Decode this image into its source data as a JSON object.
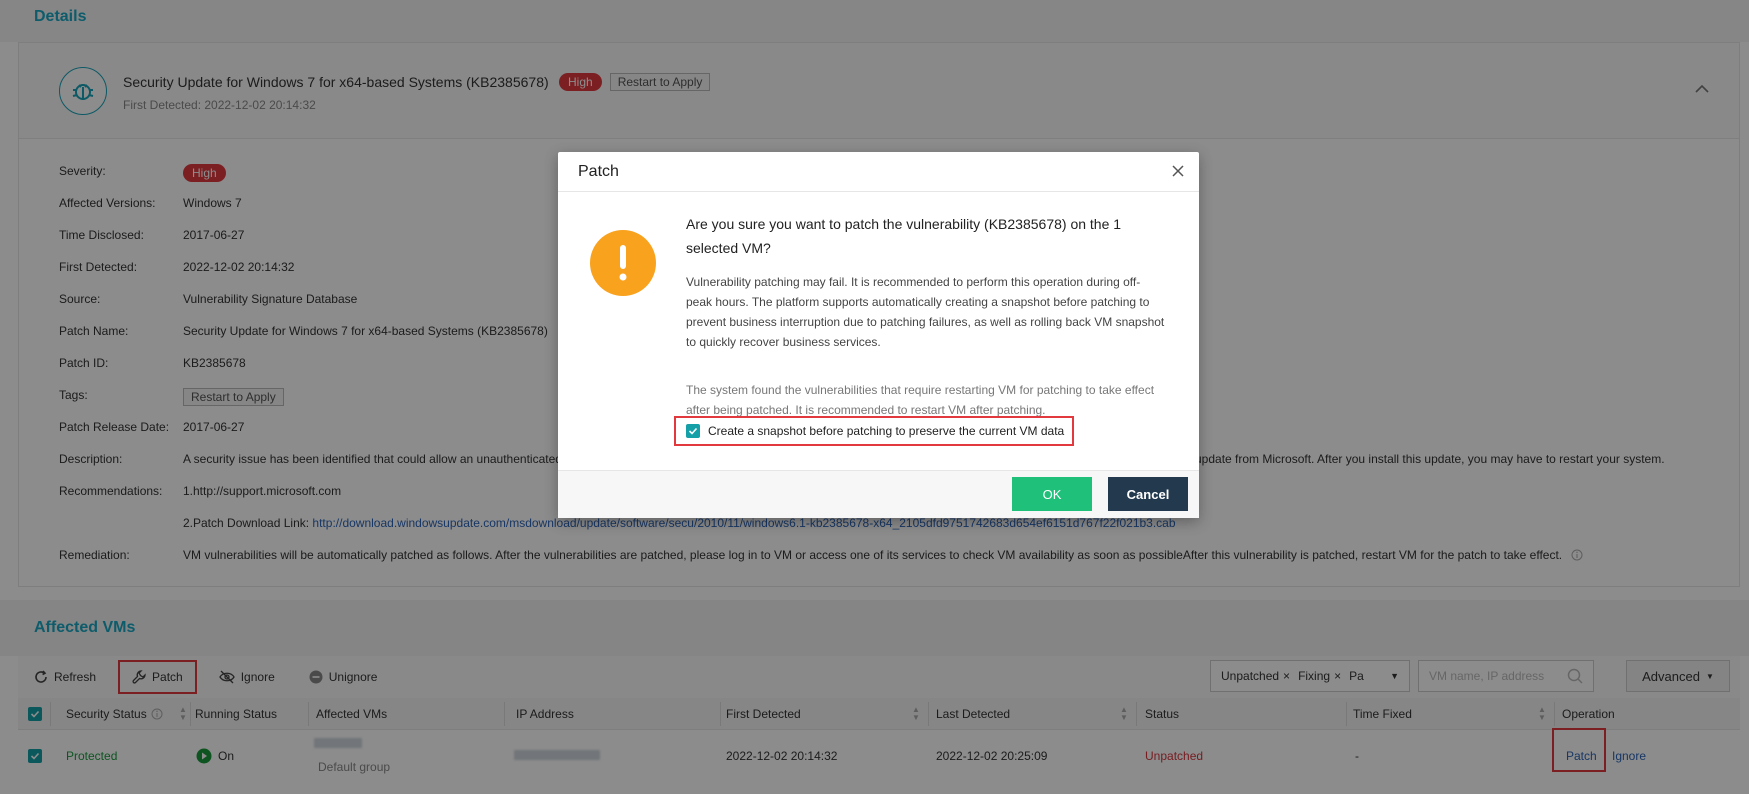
{
  "details_section_title": "Details",
  "patch_card": {
    "title": "Security Update for Windows 7 for x64-based Systems (KB2385678)",
    "severity_badge": "High",
    "restart_tag": "Restart to Apply",
    "first_detected": "First Detected: 2022-12-02 20:14:32"
  },
  "fields": [
    {
      "label": "Severity:",
      "value": "High"
    },
    {
      "label": "Affected Versions:",
      "value": "Windows 7"
    },
    {
      "label": "Time Disclosed:",
      "value": "2017-06-27"
    },
    {
      "label": "First Detected:",
      "value": "2022-12-02 20:14:32"
    },
    {
      "label": "Source:",
      "value": "Vulnerability Signature Database"
    },
    {
      "label": "Patch Name:",
      "value": "Security Update for Windows 7 for x64-based Systems (KB2385678)"
    },
    {
      "label": "Patch ID:",
      "value": "KB2385678"
    },
    {
      "label": "Tags:",
      "value": "Restart to Apply"
    },
    {
      "label": "Patch Release Date:",
      "value": "2017-06-27"
    },
    {
      "label": "Description:",
      "value": "A security issue has been identified that could allow an unauthenticated",
      "value_tail": "update from Microsoft. After you install this update, you may have to restart your system."
    },
    {
      "label": "Recommendations:",
      "value": "1.http://support.microsoft.com"
    },
    {
      "label": "",
      "value": "2.Patch Download Link: ",
      "link": "http://download.windowsupdate.com/msdownload/update/software/secu/2010/11/windows6.1-kb2385678-x64_2105dfd9751742683d654ef6151d767f22f021b3.cab"
    },
    {
      "label": "Remediation:",
      "value": "VM vulnerabilities will be automatically patched as follows. After the vulnerabilities are patched, please log in to VM or access one of its services to check VM availability as soon as possibleAfter this vulnerability is patched, restart VM for the patch to take effect."
    }
  ],
  "affected_vms_title": "Affected VMs",
  "toolbar": {
    "refresh": "Refresh",
    "patch": "Patch",
    "ignore": "Ignore",
    "unignore": "Unignore"
  },
  "filters": {
    "chips": [
      "Unpatched",
      "Fixing",
      "Pa"
    ],
    "search_placeholder": "VM name, IP address",
    "advanced": "Advanced"
  },
  "table": {
    "headers": [
      "Security Status",
      "Running Status",
      "Affected VMs",
      "IP Address",
      "First Detected",
      "Last Detected",
      "Status",
      "Time Fixed",
      "Operation"
    ],
    "row": {
      "security_status": "Protected",
      "running_status": "On",
      "vm_group": "Default group",
      "first_detected": "2022-12-02 20:14:32",
      "last_detected": "2022-12-02 20:25:09",
      "status": "Unpatched",
      "time_fixed": "-",
      "op_patch": "Patch",
      "op_ignore": "Ignore"
    }
  },
  "modal": {
    "title": "Patch",
    "question": "Are you sure you want to patch the vulnerability (KB2385678) on the 1 selected VM?",
    "description": "Vulnerability patching may fail. It is recommended to perform this operation during off-peak hours. The platform supports automatically creating a snapshot before patching to prevent business interruption due to patching failures, as well as rolling back VM snapshot to quickly recover business services.",
    "note": "The system found the vulnerabilities that require restarting VM for patching to take effect after being patched. It is recommended to restart VM after patching.",
    "snapshot_label": "Create a snapshot before patching to preserve the current VM data",
    "ok": "OK",
    "cancel": "Cancel"
  },
  "colors": {
    "accent_teal": "#1aa8c4",
    "high_red": "#e0393e",
    "warning_orange": "#f8a21e",
    "ok_green": "#1ec07a",
    "cancel_navy": "#233a4e",
    "highlight_red": "#e2393e"
  }
}
